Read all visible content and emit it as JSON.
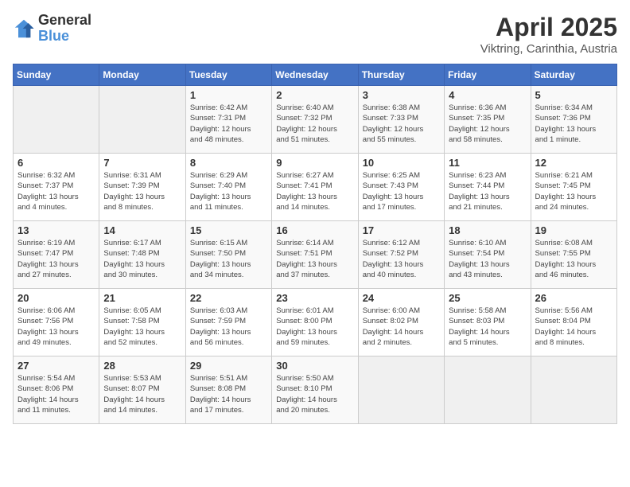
{
  "logo": {
    "text_general": "General",
    "text_blue": "Blue"
  },
  "header": {
    "month_year": "April 2025",
    "location": "Viktring, Carinthia, Austria"
  },
  "weekdays": [
    "Sunday",
    "Monday",
    "Tuesday",
    "Wednesday",
    "Thursday",
    "Friday",
    "Saturday"
  ],
  "weeks": [
    [
      {
        "day": "",
        "info": ""
      },
      {
        "day": "",
        "info": ""
      },
      {
        "day": "1",
        "info": "Sunrise: 6:42 AM\nSunset: 7:31 PM\nDaylight: 12 hours\nand 48 minutes."
      },
      {
        "day": "2",
        "info": "Sunrise: 6:40 AM\nSunset: 7:32 PM\nDaylight: 12 hours\nand 51 minutes."
      },
      {
        "day": "3",
        "info": "Sunrise: 6:38 AM\nSunset: 7:33 PM\nDaylight: 12 hours\nand 55 minutes."
      },
      {
        "day": "4",
        "info": "Sunrise: 6:36 AM\nSunset: 7:35 PM\nDaylight: 12 hours\nand 58 minutes."
      },
      {
        "day": "5",
        "info": "Sunrise: 6:34 AM\nSunset: 7:36 PM\nDaylight: 13 hours\nand 1 minute."
      }
    ],
    [
      {
        "day": "6",
        "info": "Sunrise: 6:32 AM\nSunset: 7:37 PM\nDaylight: 13 hours\nand 4 minutes."
      },
      {
        "day": "7",
        "info": "Sunrise: 6:31 AM\nSunset: 7:39 PM\nDaylight: 13 hours\nand 8 minutes."
      },
      {
        "day": "8",
        "info": "Sunrise: 6:29 AM\nSunset: 7:40 PM\nDaylight: 13 hours\nand 11 minutes."
      },
      {
        "day": "9",
        "info": "Sunrise: 6:27 AM\nSunset: 7:41 PM\nDaylight: 13 hours\nand 14 minutes."
      },
      {
        "day": "10",
        "info": "Sunrise: 6:25 AM\nSunset: 7:43 PM\nDaylight: 13 hours\nand 17 minutes."
      },
      {
        "day": "11",
        "info": "Sunrise: 6:23 AM\nSunset: 7:44 PM\nDaylight: 13 hours\nand 21 minutes."
      },
      {
        "day": "12",
        "info": "Sunrise: 6:21 AM\nSunset: 7:45 PM\nDaylight: 13 hours\nand 24 minutes."
      }
    ],
    [
      {
        "day": "13",
        "info": "Sunrise: 6:19 AM\nSunset: 7:47 PM\nDaylight: 13 hours\nand 27 minutes."
      },
      {
        "day": "14",
        "info": "Sunrise: 6:17 AM\nSunset: 7:48 PM\nDaylight: 13 hours\nand 30 minutes."
      },
      {
        "day": "15",
        "info": "Sunrise: 6:15 AM\nSunset: 7:50 PM\nDaylight: 13 hours\nand 34 minutes."
      },
      {
        "day": "16",
        "info": "Sunrise: 6:14 AM\nSunset: 7:51 PM\nDaylight: 13 hours\nand 37 minutes."
      },
      {
        "day": "17",
        "info": "Sunrise: 6:12 AM\nSunset: 7:52 PM\nDaylight: 13 hours\nand 40 minutes."
      },
      {
        "day": "18",
        "info": "Sunrise: 6:10 AM\nSunset: 7:54 PM\nDaylight: 13 hours\nand 43 minutes."
      },
      {
        "day": "19",
        "info": "Sunrise: 6:08 AM\nSunset: 7:55 PM\nDaylight: 13 hours\nand 46 minutes."
      }
    ],
    [
      {
        "day": "20",
        "info": "Sunrise: 6:06 AM\nSunset: 7:56 PM\nDaylight: 13 hours\nand 49 minutes."
      },
      {
        "day": "21",
        "info": "Sunrise: 6:05 AM\nSunset: 7:58 PM\nDaylight: 13 hours\nand 52 minutes."
      },
      {
        "day": "22",
        "info": "Sunrise: 6:03 AM\nSunset: 7:59 PM\nDaylight: 13 hours\nand 56 minutes."
      },
      {
        "day": "23",
        "info": "Sunrise: 6:01 AM\nSunset: 8:00 PM\nDaylight: 13 hours\nand 59 minutes."
      },
      {
        "day": "24",
        "info": "Sunrise: 6:00 AM\nSunset: 8:02 PM\nDaylight: 14 hours\nand 2 minutes."
      },
      {
        "day": "25",
        "info": "Sunrise: 5:58 AM\nSunset: 8:03 PM\nDaylight: 14 hours\nand 5 minutes."
      },
      {
        "day": "26",
        "info": "Sunrise: 5:56 AM\nSunset: 8:04 PM\nDaylight: 14 hours\nand 8 minutes."
      }
    ],
    [
      {
        "day": "27",
        "info": "Sunrise: 5:54 AM\nSunset: 8:06 PM\nDaylight: 14 hours\nand 11 minutes."
      },
      {
        "day": "28",
        "info": "Sunrise: 5:53 AM\nSunset: 8:07 PM\nDaylight: 14 hours\nand 14 minutes."
      },
      {
        "day": "29",
        "info": "Sunrise: 5:51 AM\nSunset: 8:08 PM\nDaylight: 14 hours\nand 17 minutes."
      },
      {
        "day": "30",
        "info": "Sunrise: 5:50 AM\nSunset: 8:10 PM\nDaylight: 14 hours\nand 20 minutes."
      },
      {
        "day": "",
        "info": ""
      },
      {
        "day": "",
        "info": ""
      },
      {
        "day": "",
        "info": ""
      }
    ]
  ]
}
